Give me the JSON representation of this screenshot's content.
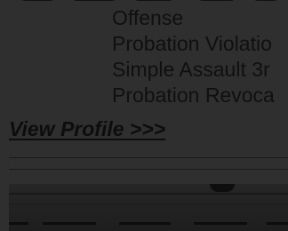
{
  "offenses": [
    "Offense",
    "Probation Violatio",
    "Simple Assault 3r",
    "Probation Revoca"
  ],
  "view_profile_link": "View Profile >>>",
  "colors": {
    "page_background": "#2f2f2f",
    "text": "#101010",
    "rule": "#1a1a1a"
  }
}
